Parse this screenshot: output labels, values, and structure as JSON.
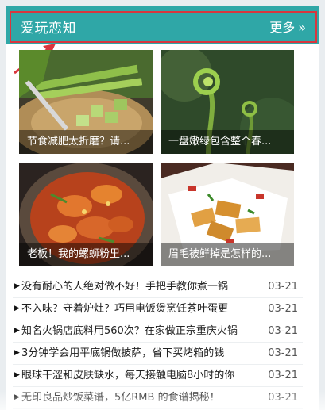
{
  "header": {
    "title": "爱玩恋知",
    "more_label": "更多",
    "more_icon": "double-chevron-right-icon"
  },
  "colors": {
    "header_bg": "#2fa7a7",
    "highlight_border": "#d9363e",
    "annotation_arrow": "#d9363e"
  },
  "cards": [
    {
      "caption": "节食减肥太折磨？请..."
    },
    {
      "caption": "一盘嫩绿包含整个春..."
    },
    {
      "caption": "老板！我的螺蛳粉里..."
    },
    {
      "caption": "眉毛被鲜掉是怎样的..."
    }
  ],
  "news": [
    {
      "title": "没有耐心的人绝对做不好！手把手教你煮一锅",
      "date": "03-21"
    },
    {
      "title": "不入味？守着炉灶？巧用电饭煲烹饪茶叶蛋更",
      "date": "03-21"
    },
    {
      "title": "知名火锅店底料用560次？在家做正宗重庆火锅",
      "date": "03-21"
    },
    {
      "title": "3分钟学会用平底锅做披萨，省下买烤箱的钱",
      "date": "03-21"
    },
    {
      "title": "眼球干涩和皮肤缺水，每天接触电脑8小时的你",
      "date": "03-21"
    },
    {
      "title": "无印良品炒饭菜谱，5亿RMB 的食谱揭秘！",
      "date": "03-21"
    }
  ]
}
